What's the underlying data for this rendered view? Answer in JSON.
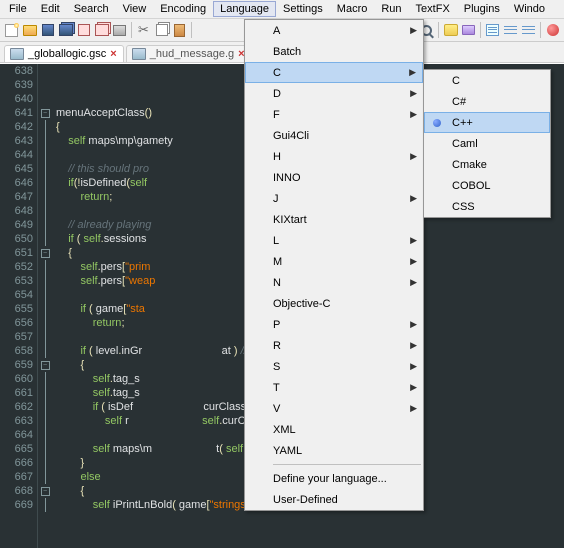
{
  "menubar": [
    "File",
    "Edit",
    "Search",
    "View",
    "Encoding",
    "Language",
    "Settings",
    "Macro",
    "Run",
    "TextFX",
    "Plugins",
    "Windo"
  ],
  "menubar_open_index": 5,
  "tabs": [
    {
      "label": "_globallogic.gsc",
      "active": true
    },
    {
      "label": "_hud_message.g",
      "active": false
    }
  ],
  "dropdown_main": [
    {
      "label": "A",
      "arrow": true
    },
    {
      "label": "Batch",
      "arrow": false
    },
    {
      "label": "C",
      "arrow": true,
      "hi": true
    },
    {
      "label": "D",
      "arrow": true
    },
    {
      "label": "F",
      "arrow": true
    },
    {
      "label": "Gui4Cli",
      "arrow": false
    },
    {
      "label": "H",
      "arrow": true
    },
    {
      "label": "INNO",
      "arrow": false
    },
    {
      "label": "J",
      "arrow": true
    },
    {
      "label": "KIXtart",
      "arrow": false
    },
    {
      "label": "L",
      "arrow": true
    },
    {
      "label": "M",
      "arrow": true
    },
    {
      "label": "N",
      "arrow": true
    },
    {
      "label": "Objective-C",
      "arrow": false
    },
    {
      "label": "P",
      "arrow": true
    },
    {
      "label": "R",
      "arrow": true
    },
    {
      "label": "S",
      "arrow": true
    },
    {
      "label": "T",
      "arrow": true
    },
    {
      "label": "V",
      "arrow": true
    },
    {
      "label": "XML",
      "arrow": false
    },
    {
      "label": "YAML",
      "arrow": false
    },
    {
      "sep": true
    },
    {
      "label": "Define your language...",
      "arrow": false
    },
    {
      "label": "User-Defined",
      "arrow": false
    }
  ],
  "dropdown_sub": [
    {
      "label": "C"
    },
    {
      "label": "C#"
    },
    {
      "label": "C++",
      "hi": true,
      "bullet": true
    },
    {
      "label": "Caml"
    },
    {
      "label": "Cmake"
    },
    {
      "label": "COBOL"
    },
    {
      "label": "CSS"
    }
  ],
  "line_start": 638,
  "line_count": 32,
  "code_lines": [
    "",
    "",
    "",
    "menuAcceptClass<span class='op'>()</span>",
    "<span class='op'>{</span>",
    "    <span class='k'>self</span> maps\\mp\\gamety",
    "",
    "    <span class='c'>// this should pro</span>",
    "    <span class='k'>if</span><span class='op'>(!</span>isDefined<span class='op'>(</span><span class='k'>self</span>",
    "        <span class='k'>return</span><span class='op'>;</span>",
    "",
    "    <span class='c'>// already playing</span>",
    "    <span class='k'>if</span> <span class='op'>(</span> <span class='k'>self</span><span class='op'>.</span>sessions",
    "    <span class='op'>{</span>",
    "        <span class='k'>self</span><span class='op'>.</span>pers<span class='op'>[</span><span class='s'>\"prim</span>",
    "        <span class='k'>self</span><span class='op'>.</span>pers<span class='op'>[</span><span class='s'>\"weap</span>",
    "",
    "        <span class='k'>if</span> <span class='op'>(</span> game<span class='op'>[</span><span class='s'>\"sta</span>                                       <span class='op'>&amp;</span>",
    "            <span class='k'>return</span><span class='op'>;</span>",
    "",
    "        <span class='k'>if</span> <span class='op'>(</span> level<span class='op'>.</span>inGr                          at <span class='op'>)</span> <span class='c'>// used weapon</span>",
    "        <span class='op'>{</span>",
    "            <span class='k'>self</span><span class='op'>.</span>tag_s",
    "            <span class='k'>self</span><span class='op'>.</span>tag_s",
    "            <span class='k'>if</span> <span class='op'>(</span> isDef                       curClass <span class='op'>!=</span> <span class='k'>self</span><span class='op'>.</span>cla",
    "                <span class='k'>self</span> r                        <span class='k'>self</span><span class='op'>.</span>curClass <span class='op'>);</span>",
    "",
    "            <span class='k'>self</span> maps\\m                     t<span class='op'>(</span> <span class='k'>self</span><span class='op'>.</span>pers<span class='op'>[</span><span class='s'>\"team\"</span>",
    "        <span class='op'>}</span>",
    "        <span class='k'>else</span>",
    "        <span class='op'>{</span>",
    "            <span class='k'>self</span> iPrintLnBold<span class='op'>(</span> game<span class='op'>[</span><span class='s'>\"strings\"</span><span class='op'>][</span><span class='s'>\"change class\"</span><span class='op'>] );</span>"
  ],
  "fold_marks": {
    "641": "-",
    "642": "|",
    "643": "|",
    "644": "|",
    "645": "|",
    "646": "|",
    "647": "|",
    "648": "|",
    "649": "|",
    "650": "|",
    "651": "-",
    "652": "|",
    "653": "|",
    "654": "|",
    "655": "|",
    "656": "|",
    "657": "|",
    "658": "|",
    "659": "-",
    "660": "|",
    "661": "|",
    "662": "|",
    "663": "|",
    "664": "|",
    "665": "|",
    "666": "|",
    "667": "|",
    "668": "-",
    "669": "|"
  }
}
